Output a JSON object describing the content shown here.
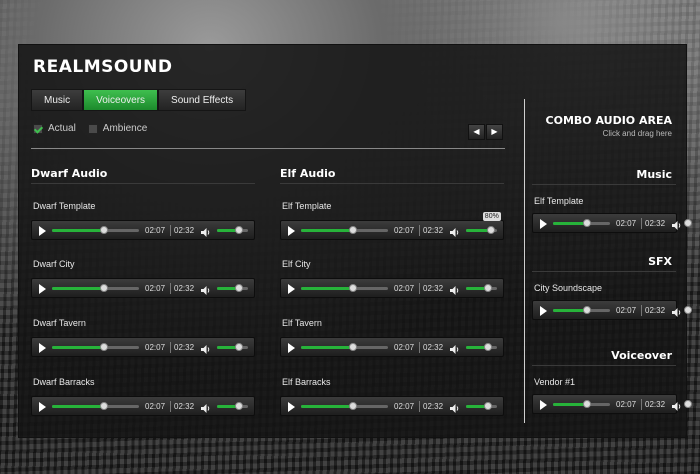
{
  "app": {
    "title": "REALMSOUND"
  },
  "tabs": [
    {
      "label": "Music",
      "active": false
    },
    {
      "label": "Voiceovers",
      "active": true
    },
    {
      "label": "Sound Effects",
      "active": false
    }
  ],
  "filters": [
    {
      "label": "Actual",
      "checked": true
    },
    {
      "label": "Ambience",
      "checked": false
    }
  ],
  "pager": {
    "prev_icon": "triangle-left-icon",
    "next_icon": "triangle-right-icon"
  },
  "columns": [
    {
      "heading": "Dwarf Audio",
      "items": [
        {
          "label": "Dwarf Template",
          "elapsed": "02:07",
          "duration": "02:32",
          "progress": 0.6,
          "volume": 0.7
        },
        {
          "label": "Dwarf City",
          "elapsed": "02:07",
          "duration": "02:32",
          "progress": 0.6,
          "volume": 0.7
        },
        {
          "label": "Dwarf Tavern",
          "elapsed": "02:07",
          "duration": "02:32",
          "progress": 0.6,
          "volume": 0.7
        },
        {
          "label": "Dwarf Barracks",
          "elapsed": "02:07",
          "duration": "02:32",
          "progress": 0.6,
          "volume": 0.7
        }
      ]
    },
    {
      "heading": "Elf Audio",
      "items": [
        {
          "label": "Elf Template",
          "elapsed": "02:07",
          "duration": "02:32",
          "progress": 0.6,
          "volume": 0.8,
          "tooltip": "80%"
        },
        {
          "label": "Elf City",
          "elapsed": "02:07",
          "duration": "02:32",
          "progress": 0.6,
          "volume": 0.7
        },
        {
          "label": "Elf Tavern",
          "elapsed": "02:07",
          "duration": "02:32",
          "progress": 0.6,
          "volume": 0.7
        },
        {
          "label": "Elf Barracks",
          "elapsed": "02:07",
          "duration": "02:32",
          "progress": 0.6,
          "volume": 0.7
        }
      ]
    }
  ],
  "combo": {
    "title": "COMBO AUDIO AREA",
    "subtitle": "Click and drag here",
    "sections": [
      {
        "heading": "Music",
        "item": {
          "label": "Elf Template",
          "elapsed": "02:07",
          "duration": "02:32",
          "progress": 0.6,
          "volume": 0.7
        }
      },
      {
        "heading": "SFX",
        "item": {
          "label": "City Soundscape",
          "elapsed": "02:07",
          "duration": "02:32",
          "progress": 0.6,
          "volume": 0.7
        }
      },
      {
        "heading": "Voiceover",
        "item": {
          "label": "Vendor #1",
          "elapsed": "02:07",
          "duration": "02:32",
          "progress": 0.6,
          "volume": 0.7
        }
      }
    ]
  },
  "colors": {
    "accent": "#27b33a",
    "tab_active": "#2fa53f",
    "panel": "#161616"
  }
}
